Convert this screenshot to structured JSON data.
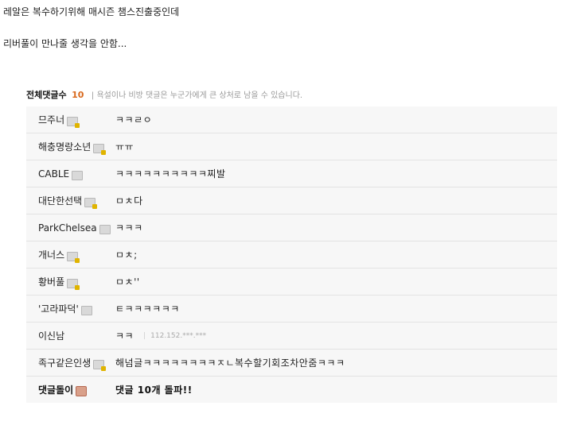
{
  "post": {
    "line1": "레알은 복수하기위해 매시즌 챔스진출중인데",
    "line2": "리버풀이 만나줄 생각을 안함..."
  },
  "comments": {
    "title": "전체댓글수",
    "count": "10",
    "notice": "| 욕설이나 비방 댓글은 누군가에게 큰 상처로 남을 수 있습니다.",
    "items": [
      {
        "nick": "므주너",
        "text": "ㅋㅋㄹㅇ"
      },
      {
        "nick": "해충명랑소년",
        "text": "ㅠㅠ"
      },
      {
        "nick": "CABLE",
        "text": "ㅋㅋㅋㅋㅋㅋㅋㅋㅋㅋ찌발"
      },
      {
        "nick": "대단한선택",
        "text": "ㅁㅊ다"
      },
      {
        "nick": "ParkChelsea",
        "text": "ㅋㅋㅋ"
      },
      {
        "nick": "개너스",
        "text": "ㅁㅊ;"
      },
      {
        "nick": "황버풀",
        "text": "ㅁㅊ''"
      },
      {
        "nick": "'고라파덕'",
        "text": "ㅌㅋㅋㅋㅋㅋㅋ"
      },
      {
        "nick": "이신남",
        "text": "ㅋㅋ",
        "ip": "112.152.***.***"
      },
      {
        "nick": "족구같은인생",
        "text": "해넘글ㅋㅋㅋㅋㅋㅋㅋㅋㅈㄴ복수할기회조차안줌ㅋㅋㅋ"
      },
      {
        "nick": "댓글돌이",
        "text": "댓글 10개 돌파!!"
      }
    ]
  }
}
